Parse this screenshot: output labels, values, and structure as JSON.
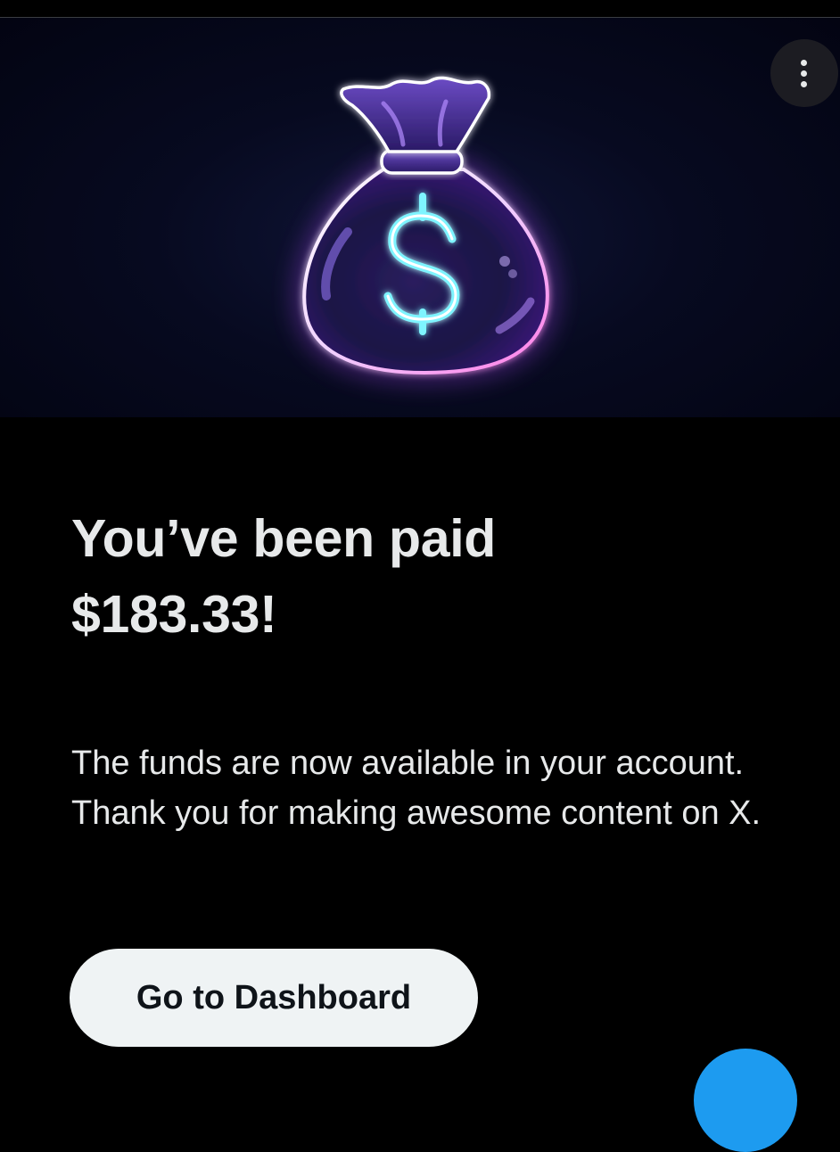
{
  "hero": {
    "icon": "money-bag-neon",
    "symbol": "$",
    "menu_icon": "more-vertical-icon"
  },
  "headline": {
    "line1": "You’ve been paid",
    "line2": "$183.33!"
  },
  "message": "The funds are now available in your account. Thank you for making awesome content on X.",
  "primary_button": {
    "label": "Go to Dashboard"
  },
  "fab": {
    "icon": "compose-icon"
  },
  "colors": {
    "background": "#000000",
    "text": "#e7e9ea",
    "button_bg": "#eff3f4",
    "button_text": "#0f1419",
    "accent": "#1d9bf0",
    "neon_purple": "#c36bff",
    "neon_cyan": "#3ee8ff"
  }
}
